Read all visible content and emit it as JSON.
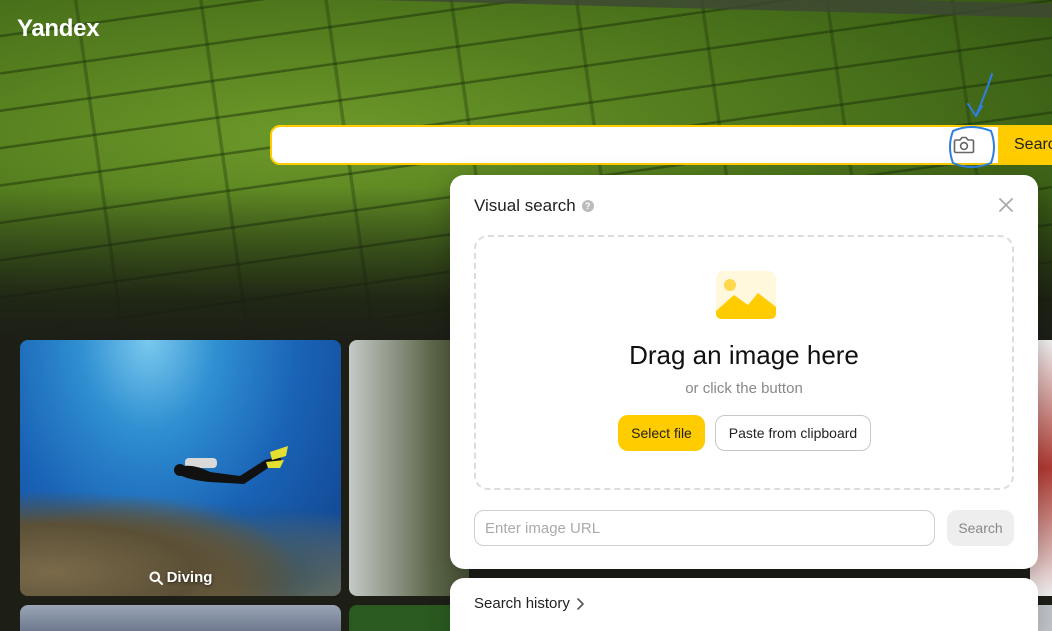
{
  "header": {
    "logo": "Yandex"
  },
  "search": {
    "value": "",
    "button_label": "Search"
  },
  "colors": {
    "accent": "#ffcc00",
    "annotation": "#2f7fe0"
  },
  "tiles": [
    {
      "caption": "Diving"
    }
  ],
  "visual_search": {
    "title": "Visual search",
    "drop_title": "Drag an image here",
    "drop_subtitle": "or click the button",
    "select_file_label": "Select file",
    "paste_label": "Paste from clipboard",
    "url_placeholder": "Enter image URL",
    "url_search_label": "Search"
  },
  "history": {
    "label": "Search history"
  }
}
